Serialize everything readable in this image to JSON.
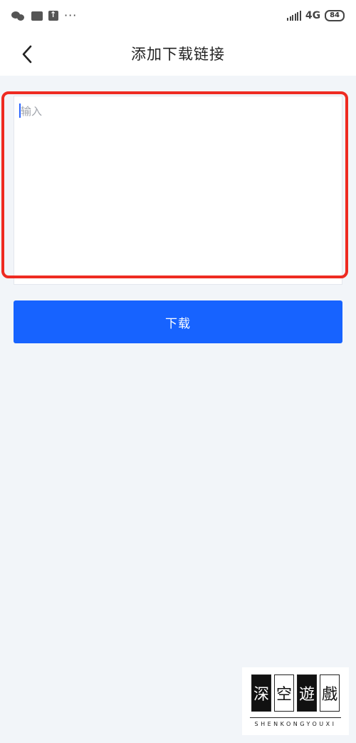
{
  "status_bar": {
    "left_icons": [
      "wechat-icon",
      "message-icon",
      "upload-icon",
      "more-dots-icon"
    ],
    "more_dots": "···",
    "network": "4G",
    "battery": "84"
  },
  "header": {
    "title": "添加下载链接",
    "back_icon": "chevron-left-icon"
  },
  "link_input": {
    "placeholder": "输入",
    "value": ""
  },
  "download_button": {
    "label": "下载",
    "color": "#1763ff"
  },
  "highlight": {
    "color": "#ee2b22"
  },
  "watermark": {
    "chars": [
      "深",
      "空",
      "遊",
      "戲"
    ],
    "subtitle": "SHENKONGYOUXI"
  }
}
